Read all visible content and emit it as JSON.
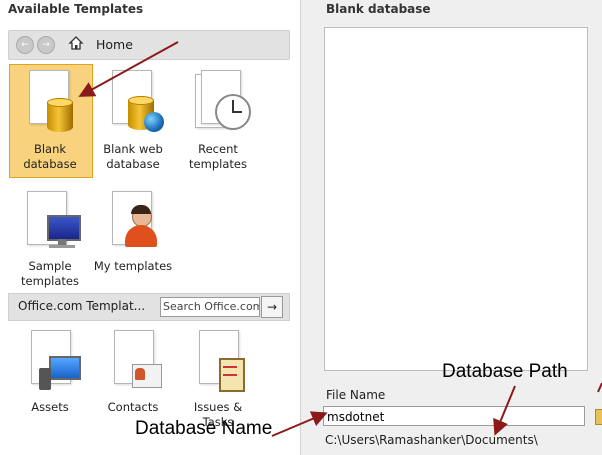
{
  "left": {
    "title": "Available Templates",
    "nav": {
      "back": "←",
      "forward": "→",
      "home_label": "Home"
    },
    "templates": [
      {
        "label_line1": "Blank",
        "label_line2": "database"
      },
      {
        "label_line1": "Blank web",
        "label_line2": "database"
      },
      {
        "label_line1": "Recent",
        "label_line2": "templates"
      },
      {
        "label_line1": "Sample",
        "label_line2": "templates"
      },
      {
        "label_line1": "My templates",
        "label_line2": ""
      }
    ],
    "office": {
      "title": "Office.com Templat...",
      "search_placeholder": "Search Office.com",
      "go": "→"
    },
    "office_templates": [
      {
        "label_line1": "Assets",
        "label_line2": ""
      },
      {
        "label_line1": "Contacts",
        "label_line2": ""
      },
      {
        "label_line1": "Issues &",
        "label_line2": "Tasks"
      }
    ]
  },
  "right": {
    "title": "Blank database",
    "file_name_label": "File Name",
    "file_name_value": "msdotnet",
    "path": "C:\\Users\\Ramashanker\\Documents\\"
  },
  "annotations": {
    "db_name": "Database Name",
    "db_path": "Database Path"
  },
  "colors": {
    "selected_bg": "#f8d27c",
    "selected_border": "#e0a51d",
    "arrow": "#8b1a1a"
  }
}
